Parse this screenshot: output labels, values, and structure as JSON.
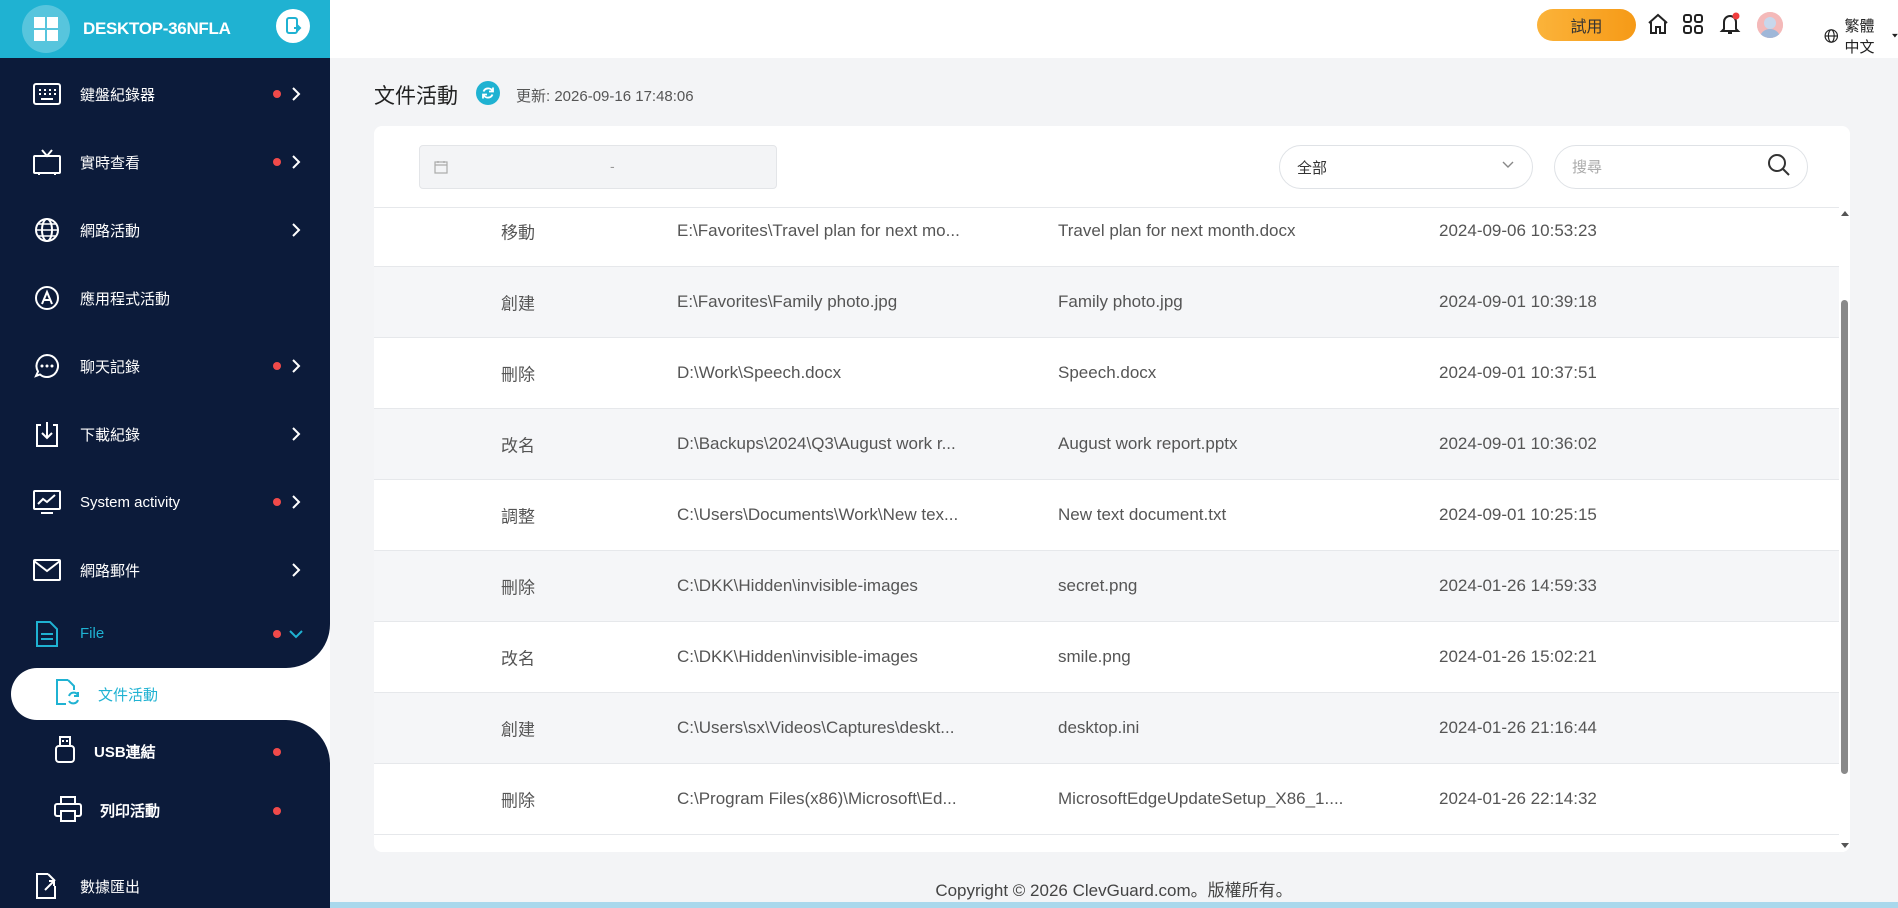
{
  "sidebar": {
    "device_name": "DESKTOP-36NFLA",
    "items": [
      {
        "label": "鍵盤紀錄器",
        "icon": "keyboard-icon",
        "dot": true,
        "chevron": "right"
      },
      {
        "label": "實時查看",
        "icon": "tv-icon",
        "dot": true,
        "chevron": "right"
      },
      {
        "label": "網路活動",
        "icon": "globe-icon",
        "dot": false,
        "chevron": "right"
      },
      {
        "label": "應用程式活動",
        "icon": "app-store-icon",
        "dot": false,
        "chevron": "none"
      },
      {
        "label": "聊天記錄",
        "icon": "chat-bubble-icon",
        "dot": true,
        "chevron": "right"
      },
      {
        "label": "下載紀錄",
        "icon": "download-icon",
        "dot": false,
        "chevron": "right"
      },
      {
        "label": "System activity",
        "icon": "monitor-chart-icon",
        "dot": true,
        "chevron": "right"
      },
      {
        "label": "網路郵件",
        "icon": "mail-icon",
        "dot": false,
        "chevron": "right"
      }
    ],
    "file_group": {
      "label": "File",
      "icon": "document-icon",
      "dot": true,
      "chevron": "down"
    },
    "sub_items": [
      {
        "label": "文件活動",
        "icon": "file-sync-icon",
        "dot": false,
        "active": true
      },
      {
        "label": "USB連結",
        "icon": "usb-icon",
        "dot": true,
        "active": false
      },
      {
        "label": "列印活動",
        "icon": "printer-icon",
        "dot": true,
        "active": false
      }
    ],
    "export_label": "數據匯出",
    "accent": "#1fb2d2",
    "bg": "#0c1b3a"
  },
  "topbar": {
    "trial_label": "試用",
    "language": "繁體中文"
  },
  "page": {
    "title": "文件活動",
    "update_label": "更新:  2026-09-16 17:48:06"
  },
  "filters": {
    "date_separator": "-",
    "select_value": "全部",
    "search_placeholder": "搜尋"
  },
  "table": {
    "rows": [
      {
        "action": "移動",
        "path": "E:\\Favorites\\Travel plan for next mo...",
        "file": "Travel plan for next month.docx",
        "time": "2024-09-06 10:53:23"
      },
      {
        "action": "創建",
        "path": "E:\\Favorites\\Family photo.jpg",
        "file": "Family photo.jpg",
        "time": "2024-09-01 10:39:18"
      },
      {
        "action": "刪除",
        "path": "D:\\Work\\Speech.docx",
        "file": "Speech.docx",
        "time": "2024-09-01 10:37:51"
      },
      {
        "action": "改名",
        "path": "D:\\Backups\\2024\\Q3\\August work r...",
        "file": "August work report.pptx",
        "time": "2024-09-01 10:36:02"
      },
      {
        "action": "調整",
        "path": "C:\\Users\\Documents\\Work\\New tex...",
        "file": "New text document.txt",
        "time": "2024-09-01 10:25:15"
      },
      {
        "action": "刪除",
        "path": "C:\\DKK\\Hidden\\invisible-images",
        "file": "secret.png",
        "time": "2024-01-26 14:59:33"
      },
      {
        "action": "改名",
        "path": "C:\\DKK\\Hidden\\invisible-images",
        "file": "smile.png",
        "time": "2024-01-26 15:02:21"
      },
      {
        "action": "創建",
        "path": "C:\\Users\\sx\\Videos\\Captures\\deskt...",
        "file": "desktop.ini",
        "time": "2024-01-26 21:16:44"
      },
      {
        "action": "刪除",
        "path": "C:\\Program Files(x86)\\Microsoft\\Ed...",
        "file": "MicrosoftEdgeUpdateSetup_X86_1....",
        "time": "2024-01-26 22:14:32"
      }
    ]
  },
  "footer": {
    "copyright": "Copyright © 2026 ClevGuard.com。版權所有。"
  }
}
